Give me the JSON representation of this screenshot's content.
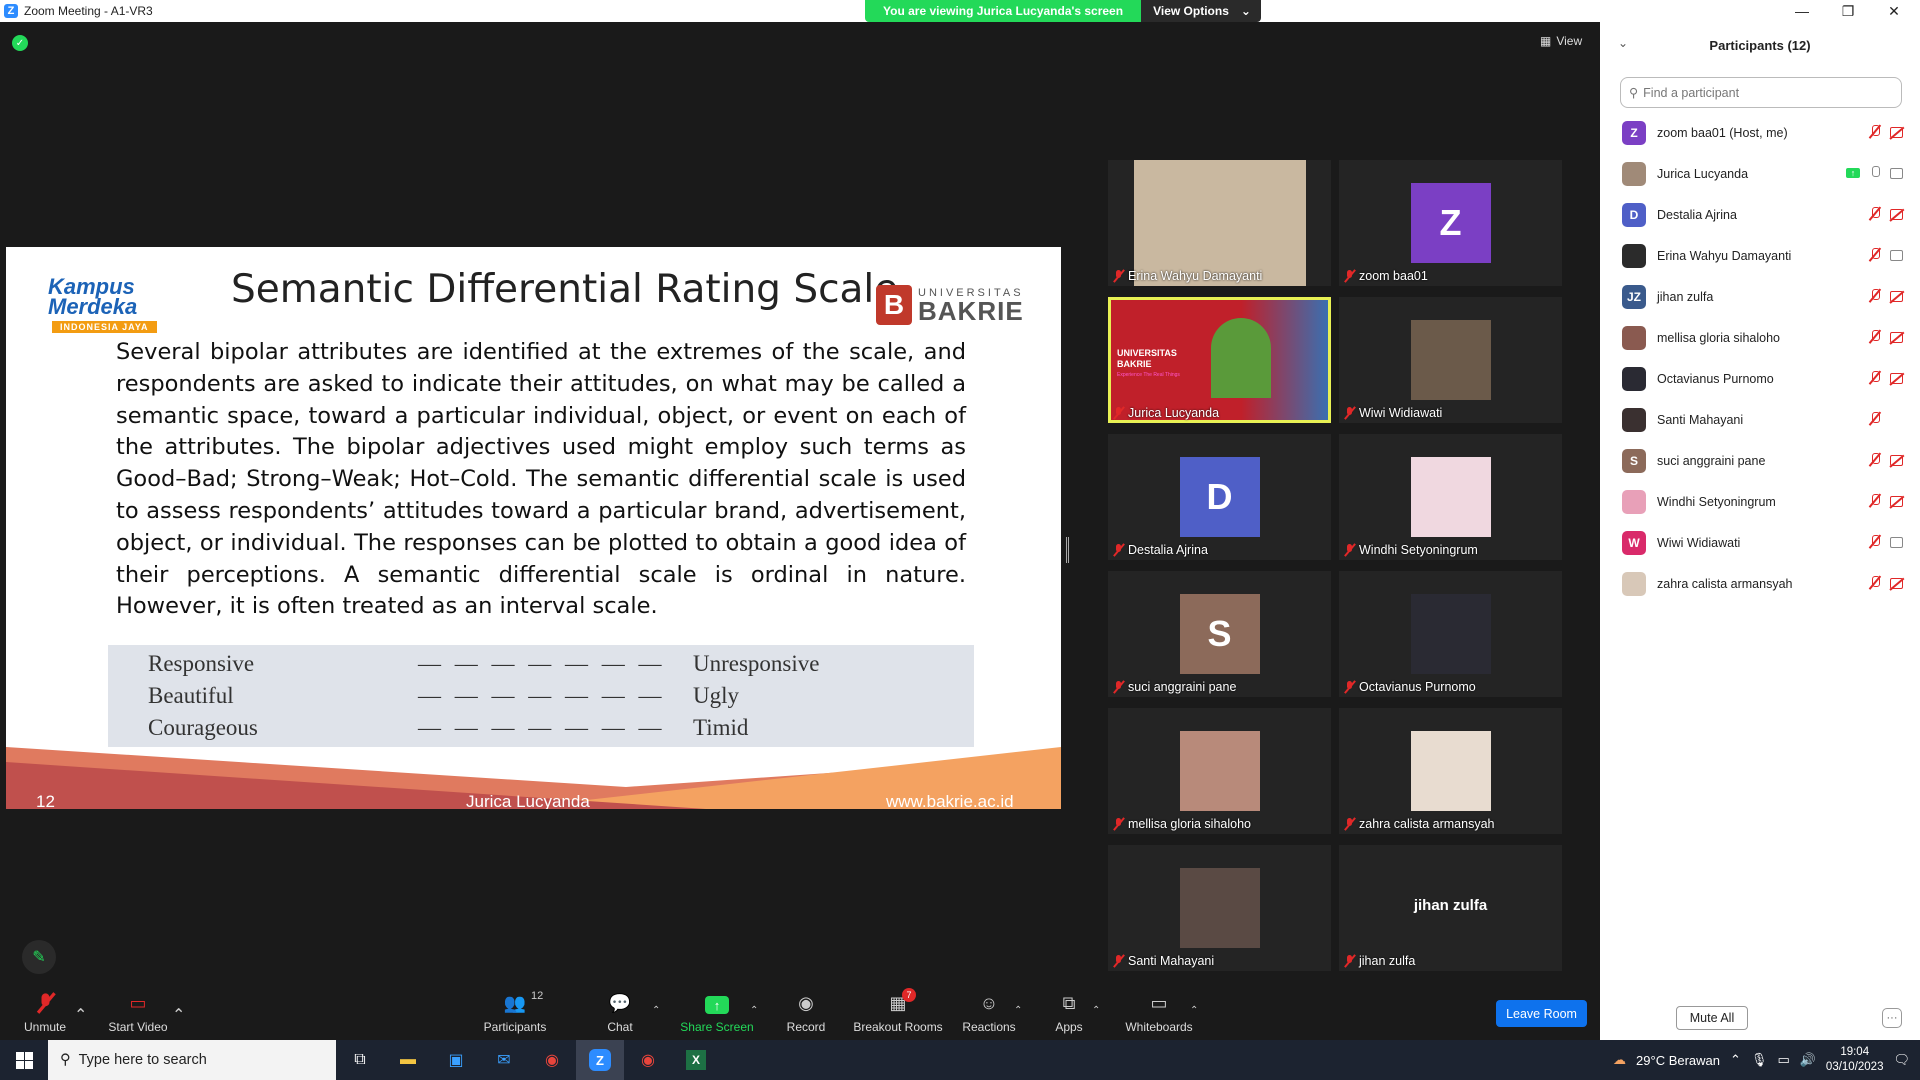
{
  "window": {
    "title": "Zoom Meeting - A1-VR3"
  },
  "viewing_banner": {
    "text": "You are viewing Jurica Lucyanda's screen",
    "options_label": "View Options"
  },
  "view_label": "View",
  "slide": {
    "title": "Semantic Differential Rating Scale",
    "logo_left_line1": "Kampus",
    "logo_left_line2": "Merdeka",
    "logo_left_tag": "INDONESIA JAYA",
    "logo_right_top": "UNIVERSITAS",
    "logo_right_name": "BAKRIE",
    "body": "Several bipolar attributes are identified at the extremes of the scale, and respondents are asked to indicate their attitudes, on what may be called a semantic space, toward a particular individual, object, or event on each of the attributes. The bipolar adjectives used might employ such terms as Good–Bad; Strong–Weak; Hot–Cold. The semantic differential scale is used to assess respondents’ attitudes toward a particular brand, advertisement, object, or individual. The responses can be plotted to obtain a good idea of their perceptions. A semantic differential scale is ordinal in nature. However, it is often treated as an interval scale.",
    "scale_rows": [
      {
        "left": "Responsive",
        "dashes": "— — — — — — —",
        "right": "Unresponsive"
      },
      {
        "left": "Beautiful",
        "dashes": "— — — — — — —",
        "right": "Ugly"
      },
      {
        "left": "Courageous",
        "dashes": "— — — — — — —",
        "right": "Timid"
      }
    ],
    "footer_page": "12",
    "footer_author": "Jurica Lucyanda",
    "footer_url": "www.bakrie.ac.id"
  },
  "video_tiles": [
    {
      "name": "Erina Wahyu Damayanti",
      "kind": "photo",
      "color": "#c9b8a0"
    },
    {
      "name": "zoom baa01",
      "kind": "letter",
      "letter": "Z",
      "color": "#7b3fc4"
    },
    {
      "name": "Jurica Lucyanda",
      "kind": "share",
      "color": "#c0202a",
      "active": true
    },
    {
      "name": "Wiwi Widiawati",
      "kind": "photo",
      "color": "#6b5a4a"
    },
    {
      "name": "Destalia Ajrina",
      "kind": "letter",
      "letter": "D",
      "color": "#4f5fc7"
    },
    {
      "name": "Windhi Setyoningrum",
      "kind": "photo",
      "color": "#f0d8e0"
    },
    {
      "name": "suci anggraini pane",
      "kind": "letter",
      "letter": "S",
      "color": "#8c6a5a"
    },
    {
      "name": "Octavianus Purnomo",
      "kind": "photo",
      "color": "#2a2a33"
    },
    {
      "name": "mellisa gloria sihaloho",
      "kind": "photo",
      "color": "#b88a7a"
    },
    {
      "name": "zahra calista armansyah",
      "kind": "photo",
      "color": "#e8dcd0"
    },
    {
      "name": "Santi Mahayani",
      "kind": "photo",
      "color": "#5a4a44"
    },
    {
      "name": "jihan zulfa",
      "kind": "textonly"
    }
  ],
  "share_tile_text": {
    "line1": "UNIVERSITAS",
    "line2": "BAKRIE",
    "tag": "Experience The Real Things"
  },
  "toolbar": {
    "unmute": "Unmute",
    "start_video": "Start Video",
    "participants": "Participants",
    "participants_count": "12",
    "chat": "Chat",
    "share_screen": "Share Screen",
    "record": "Record",
    "breakout_rooms": "Breakout Rooms",
    "breakout_badge": "7",
    "reactions": "Reactions",
    "apps": "Apps",
    "whiteboards": "Whiteboards",
    "leave": "Leave Room"
  },
  "panel": {
    "title": "Participants (12)",
    "search_placeholder": "Find a participant",
    "mute_all": "Mute All",
    "participants": [
      {
        "name": "zoom baa01 (Host, me)",
        "avatar": "Z",
        "color": "#7b3fc4",
        "mic": "off",
        "cam": "off"
      },
      {
        "name": "Jurica Lucyanda",
        "avatar": "",
        "color": "#a08a78",
        "mic": "on",
        "cam": "on",
        "sharing": true
      },
      {
        "name": "Destalia Ajrina",
        "avatar": "D",
        "color": "#4f5fc7",
        "mic": "off",
        "cam": "off"
      },
      {
        "name": "Erina Wahyu Damayanti",
        "avatar": "",
        "color": "#2b2b2b",
        "mic": "off",
        "cam": "on"
      },
      {
        "name": "jihan zulfa",
        "avatar": "JZ",
        "color": "#3a5a8c",
        "mic": "off",
        "cam": "off"
      },
      {
        "name": "mellisa gloria sihaloho",
        "avatar": "",
        "color": "#8a5a50",
        "mic": "off",
        "cam": "off"
      },
      {
        "name": "Octavianus Purnomo",
        "avatar": "",
        "color": "#2a2a33",
        "mic": "off",
        "cam": "off"
      },
      {
        "name": "Santi Mahayani",
        "avatar": "",
        "color": "#3a3030",
        "mic": "off",
        "cam": "none"
      },
      {
        "name": "suci anggraini pane",
        "avatar": "S",
        "color": "#8c6a5a",
        "mic": "off",
        "cam": "off"
      },
      {
        "name": "Windhi Setyoningrum",
        "avatar": "",
        "color": "#e8a0b8",
        "mic": "off",
        "cam": "off"
      },
      {
        "name": "Wiwi Widiawati",
        "avatar": "W",
        "color": "#d92a6a",
        "mic": "off",
        "cam": "on"
      },
      {
        "name": "zahra calista armansyah",
        "avatar": "",
        "color": "#d8c8b8",
        "mic": "off",
        "cam": "off"
      }
    ]
  },
  "taskbar": {
    "search_placeholder": "Type here to search",
    "weather": "29°C  Berawan",
    "time": "19:04",
    "date": "03/10/2023"
  }
}
